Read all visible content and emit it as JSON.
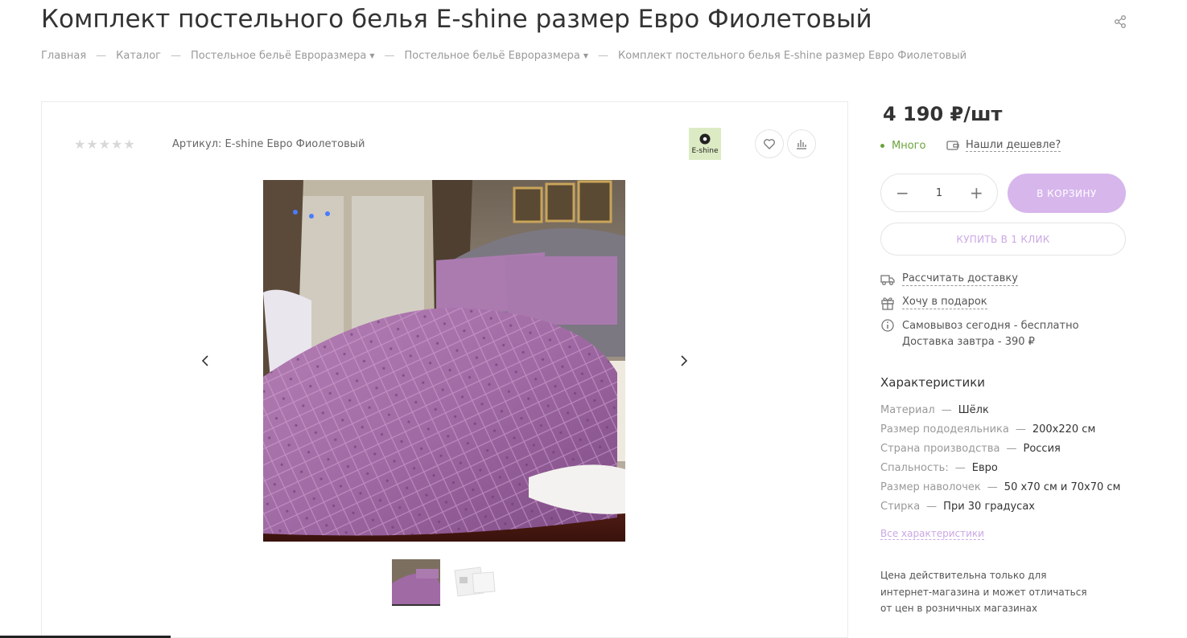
{
  "product": {
    "title": "Комплект постельного белья E-shine размер Евро Фиолетовый",
    "article_label": "Артикул:",
    "article_value": "E-shine Евро Фиолетовый",
    "rating_stars": "★★★★★",
    "brand_text": "E-shine"
  },
  "breadcrumb": [
    {
      "label": "Главная"
    },
    {
      "label": "Каталог"
    },
    {
      "label": "Постельное бельё Евроразмера",
      "dropdown": true
    },
    {
      "label": "Постельное бельё Евроразмера",
      "dropdown": true
    },
    {
      "label": "Комплект постельного белья E-shine размер Евро Фиолетовый"
    }
  ],
  "breadcrumb_separator": "—",
  "buy": {
    "price": "4 190 ₽/шт",
    "stock": "Много",
    "cheaper": "Нашли дешевле?",
    "quantity": "1",
    "cart_button": "В КОРЗИНУ",
    "one_click_button": "КУПИТЬ В 1 КЛИК"
  },
  "options": {
    "delivery_calc": "Рассчитать доставку",
    "gift": "Хочу в подарок",
    "pickup": "Самовывоз сегодня - бесплатно",
    "delivery": "Доставка завтра - 390 ₽"
  },
  "characteristics": {
    "title": "Характеристики",
    "separator": "—",
    "rows": [
      {
        "key": "Материал",
        "value": "Шёлк"
      },
      {
        "key": "Размер пододеяльника",
        "value": "200х220 см"
      },
      {
        "key": "Страна производства",
        "value": "Россия"
      },
      {
        "key": "Спальность:",
        "value": "Евро"
      },
      {
        "key": "Размер наволочек",
        "value": "50 х70 см и 70х70 см"
      },
      {
        "key": "Стирка",
        "value": "При 30 градусах"
      }
    ],
    "all_link": "Все характеристики"
  },
  "note": "Цена действительна только для интернет-магазина и может отличаться от цен в розничных магазинах",
  "colors": {
    "accent": "#d7b6ec",
    "accent_text": "#cba8e4",
    "stock_green": "#6aa33a"
  },
  "icons": [
    "share-icon",
    "heart-icon",
    "compare-icon",
    "chevron-left-icon",
    "chevron-right-icon",
    "truck-icon",
    "gift-icon",
    "info-icon",
    "wallet-icon"
  ]
}
